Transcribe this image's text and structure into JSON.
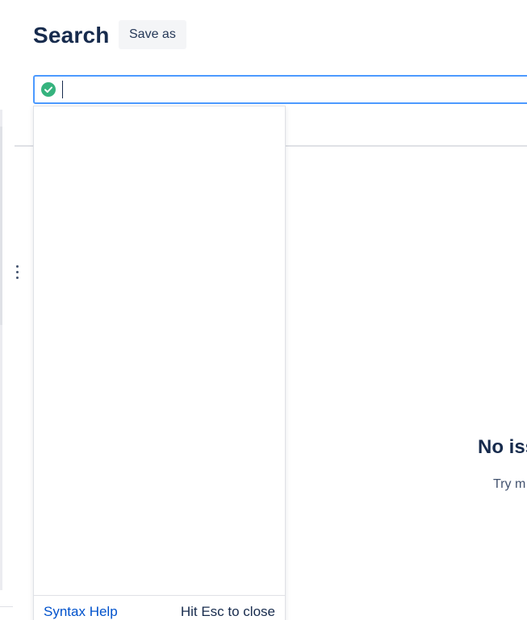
{
  "header": {
    "title": "Search",
    "save_as_label": "Save as"
  },
  "search": {
    "value": "",
    "placeholder": "",
    "status_icon": "check-circle-icon"
  },
  "dropdown": {
    "syntax_help_label": "Syntax Help",
    "close_hint": "Hit Esc to close"
  },
  "empty_state": {
    "title": "No iss",
    "text": "Try m"
  },
  "colors": {
    "focus_border": "#4c9aff",
    "valid_icon": "#36b37e",
    "link": "#0052cc",
    "heading": "#172b4d"
  }
}
